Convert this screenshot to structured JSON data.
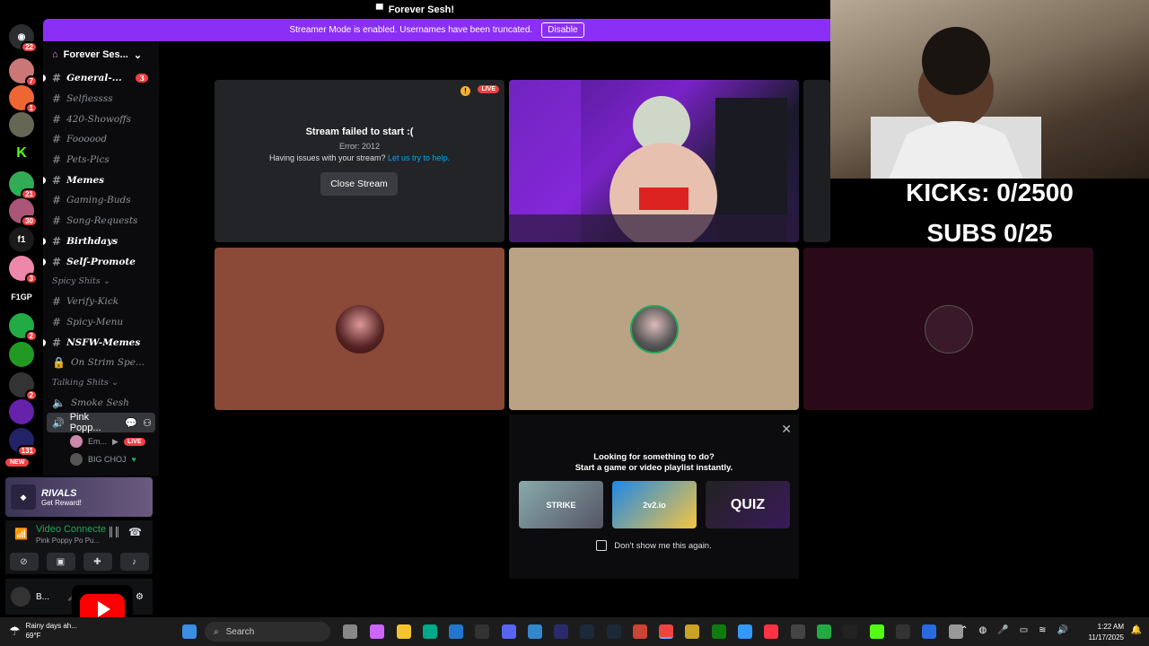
{
  "window": {
    "title": "Forever Sesh!"
  },
  "banner": {
    "text": "Streamer Mode is enabled. Usernames have been truncated.",
    "button": "Disable"
  },
  "rail": {
    "badges": [
      "22",
      "7",
      "1",
      "21",
      "30",
      "3",
      "2",
      "2",
      "131"
    ],
    "f1_label": "f1",
    "f1gp_label": "F1GP",
    "new_label": "NEW"
  },
  "server": {
    "name": "Forever Ses...",
    "channels": [
      {
        "name": "General-...",
        "unread": true,
        "mention": "3"
      },
      {
        "name": "Selfiessss",
        "unread": false
      },
      {
        "name": "420-Showoffs",
        "unread": false
      },
      {
        "name": "Foooood",
        "unread": false
      },
      {
        "name": "Pets-Pics",
        "unread": false
      },
      {
        "name": "Memes",
        "unread": true
      },
      {
        "name": "Gaming-Buds",
        "unread": false
      },
      {
        "name": "Song-Requests",
        "unread": false
      },
      {
        "name": "Birthdays",
        "unread": true
      },
      {
        "name": "Self-Promote",
        "unread": true
      }
    ],
    "category_spicy": "Spicy Shits",
    "spicy_channels": [
      {
        "name": "Verify-Kick",
        "unread": false
      },
      {
        "name": "Spicy-Menu",
        "unread": false
      },
      {
        "name": "NSFW-Memes",
        "unread": true
      },
      {
        "name": "On Strim Spe...",
        "unread": false,
        "locked": true
      }
    ],
    "category_talking": "Talking Shits",
    "voice_channels": [
      {
        "name": "Smoke Sesh"
      }
    ],
    "active_voice": "Pink Popp...",
    "voice_users": [
      {
        "name": "Em...",
        "live": "LIVE"
      },
      {
        "name": "BIG CHOJ",
        "live": ""
      }
    ]
  },
  "promo": {
    "brand": "RIVALS",
    "text": "Get Reward!"
  },
  "voice_panel": {
    "status": "Video Connecte",
    "channel": "Pink Poppy Po Pu..."
  },
  "user_panel": {
    "name": "B..."
  },
  "stream_tile": {
    "title": "Stream failed to start :(",
    "error": "Error: 2012",
    "help_prefix": "Having issues with your stream?",
    "help_link": "Let us try to help.",
    "button": "Close Stream",
    "live": "LIVE"
  },
  "activity": {
    "line1": "Looking for something to do?",
    "line2": "Start a game or video playlist instantly.",
    "games": [
      "STRIKE",
      "2v2.io",
      "QUIZ"
    ],
    "checkbox_label": "Don't show me this again."
  },
  "overlay": {
    "kicks": "KICKs: 0/2500",
    "subs": "SUBS 0/25"
  },
  "taskbar": {
    "weather_line1": "Rainy days ah...",
    "weather_line2": "69°F",
    "search_placeholder": "Search",
    "time": "1:22 AM",
    "date": "11/17/2025"
  }
}
